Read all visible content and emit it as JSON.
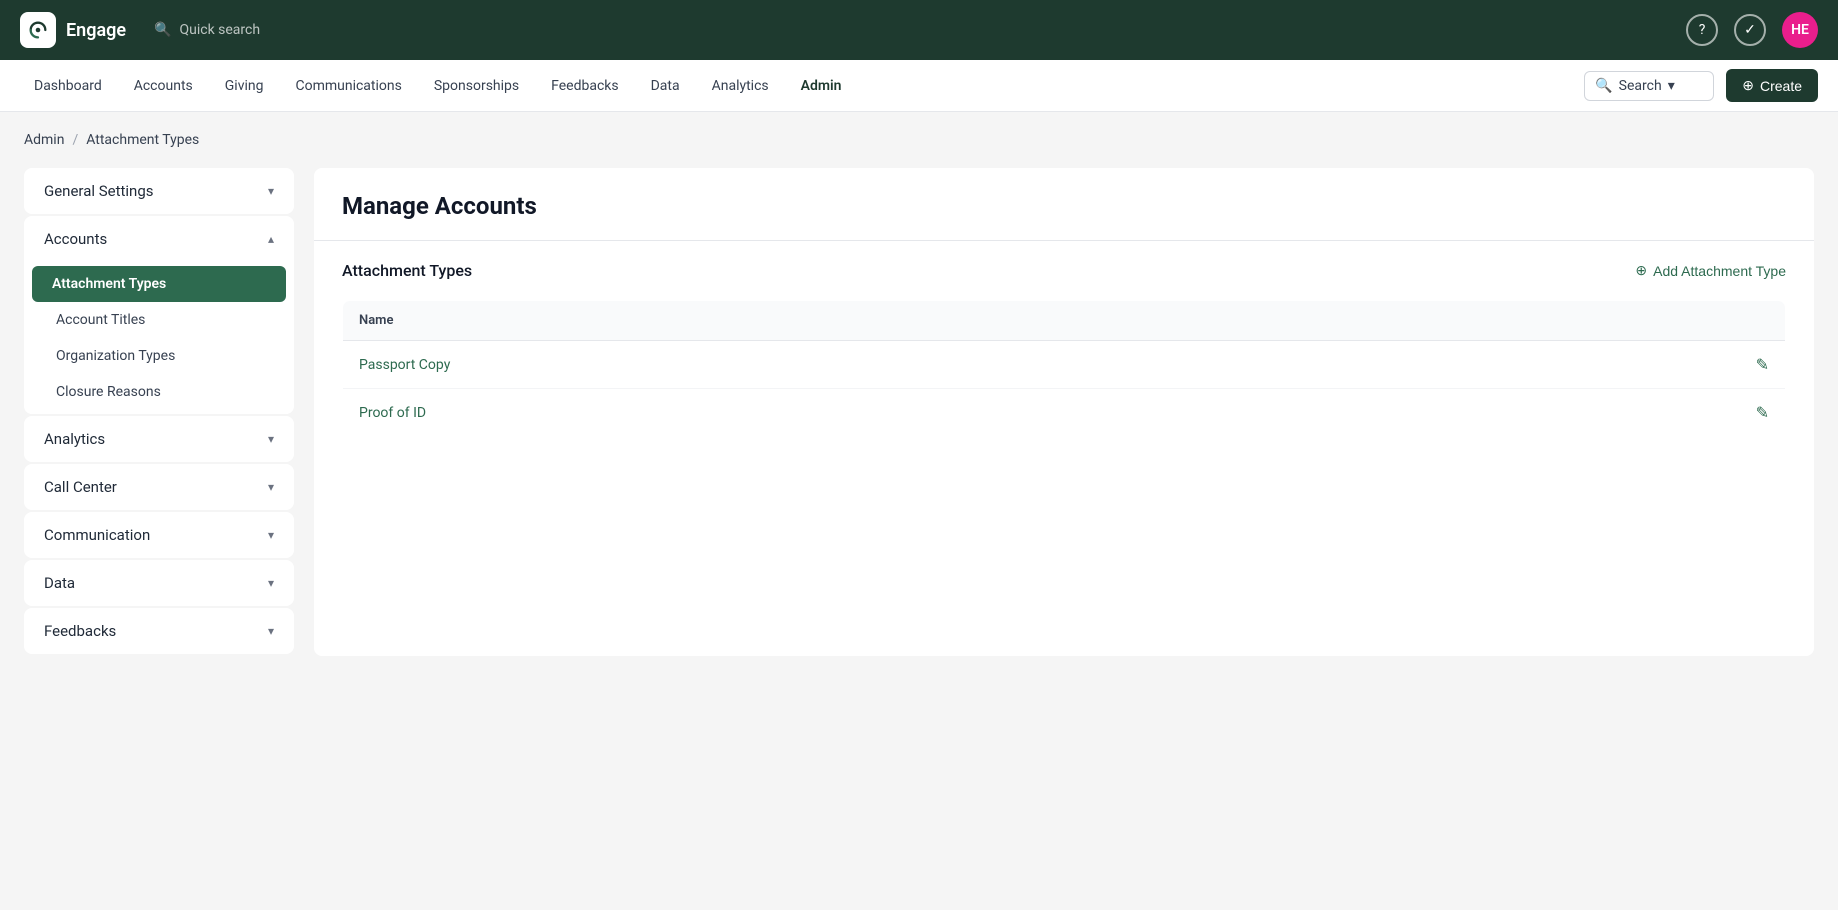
{
  "app": {
    "name": "Engage",
    "avatar_initials": "HE"
  },
  "top_search": {
    "placeholder": "Quick search"
  },
  "secondary_nav": {
    "items": [
      {
        "label": "Dashboard",
        "active": false
      },
      {
        "label": "Accounts",
        "active": false
      },
      {
        "label": "Giving",
        "active": false
      },
      {
        "label": "Communications",
        "active": false
      },
      {
        "label": "Sponsorships",
        "active": false
      },
      {
        "label": "Feedbacks",
        "active": false
      },
      {
        "label": "Data",
        "active": false
      },
      {
        "label": "Analytics",
        "active": false
      },
      {
        "label": "Admin",
        "active": true
      }
    ],
    "search_placeholder": "Search",
    "create_label": "Create"
  },
  "breadcrumb": {
    "parent": "Admin",
    "separator": "/",
    "current": "Attachment Types"
  },
  "sidebar": {
    "sections": [
      {
        "label": "General Settings",
        "expanded": false,
        "items": []
      },
      {
        "label": "Accounts",
        "expanded": true,
        "items": [
          {
            "label": "Attachment Types",
            "active": true
          },
          {
            "label": "Account Titles",
            "active": false
          },
          {
            "label": "Organization Types",
            "active": false
          },
          {
            "label": "Closure Reasons",
            "active": false
          }
        ]
      },
      {
        "label": "Analytics",
        "expanded": false,
        "items": []
      },
      {
        "label": "Call Center",
        "expanded": false,
        "items": []
      },
      {
        "label": "Communication",
        "expanded": false,
        "items": []
      },
      {
        "label": "Data",
        "expanded": false,
        "items": []
      },
      {
        "label": "Feedbacks",
        "expanded": false,
        "items": []
      }
    ]
  },
  "main": {
    "page_title": "Manage Accounts",
    "section_title": "Attachment Types",
    "add_button_label": "Add Attachment Type",
    "table": {
      "columns": [
        "Name"
      ],
      "rows": [
        {
          "name": "Passport Copy"
        },
        {
          "name": "Proof of ID"
        }
      ]
    }
  },
  "icons": {
    "chevron_down": "▾",
    "chevron_up": "▴",
    "edit": "✎",
    "add_circle": "⊕",
    "search": "🔍",
    "help": "?",
    "check": "✓"
  }
}
